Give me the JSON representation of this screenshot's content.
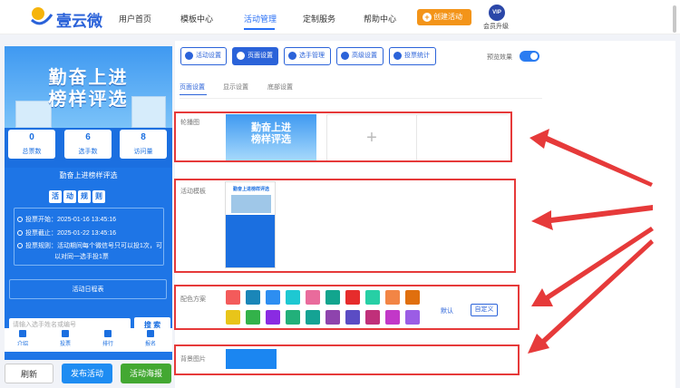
{
  "nav": {
    "brand": "壹云微",
    "items": [
      {
        "label": "用户首页"
      },
      {
        "label": "模板中心"
      },
      {
        "label": "活动管理"
      },
      {
        "label": "定制服务"
      },
      {
        "label": "帮助中心"
      }
    ],
    "create_button": "创建活动",
    "vip_badge": "VIP",
    "vip_label": "会员升级"
  },
  "preview": {
    "title_line1": "勤奋上进",
    "title_line2": "榜样评选",
    "stats": [
      {
        "value": "0",
        "label": "总票数"
      },
      {
        "value": "6",
        "label": "选手数"
      },
      {
        "value": "8",
        "label": "访问量"
      }
    ],
    "event_name": "勤奋上进榜样评选",
    "rules_title_chars": [
      "活",
      "动",
      "规",
      "则"
    ],
    "rules": [
      "投票开始：2025-01-16 13:45:16",
      "投票截止：2025-01-22 13:45:16",
      "投票规则：活动期间每个微信号只可以投1次，可",
      "以对同一选手投1票"
    ],
    "schedule": "活动日程表",
    "search_placeholder": "请输入选手姓名或编号",
    "search_button": "搜 索",
    "tabbar": [
      "介绍",
      "投票",
      "排行",
      "报名"
    ]
  },
  "left_actions": {
    "refresh": "刷新",
    "publish": "发布活动",
    "poster": "活动海报"
  },
  "toolbar": [
    {
      "label": "活动设置",
      "active": false
    },
    {
      "label": "页面设置",
      "active": true
    },
    {
      "label": "选手管理",
      "active": false
    },
    {
      "label": "高级设置",
      "active": false
    },
    {
      "label": "投票统计",
      "active": false
    }
  ],
  "preview_toggle_label": "预览效果",
  "subtabs": [
    "页面设置",
    "显示设置",
    "底部设置"
  ],
  "sections": {
    "carousel": "轮播图",
    "template": "活动模板",
    "color_scheme": "配色方案",
    "background": "背景图片"
  },
  "carousel_add": "+",
  "template_thumb_title": "勤奋上进榜样评选",
  "color_row1": [
    "#f35b5b",
    "#1a86b8",
    "#2d8ef1",
    "#1ec8d2",
    "#e96b9c",
    "#12a58e",
    "#e62c2c",
    "#27cfa5",
    "#f28545",
    "#e06f0e"
  ],
  "color_row2": [
    "#e8c51a",
    "#33b24a",
    "#8a2be2",
    "#22b07a",
    "#15a394",
    "#8e44ad",
    "#5b4cc4",
    "#c0307a",
    "#c238c8",
    "#9b5de5"
  ],
  "scheme_default": "默认",
  "scheme_custom": "自定义",
  "background_color": "#1b86f1"
}
